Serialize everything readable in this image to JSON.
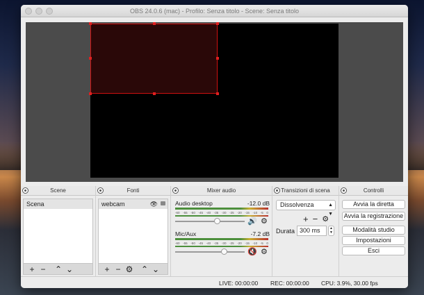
{
  "window": {
    "title": "OBS 24.0.6 (mac) - Profilo: Senza titolo - Scene: Senza titolo"
  },
  "docks": {
    "scenes": {
      "title": "Scene",
      "items": [
        "Scena"
      ]
    },
    "sources": {
      "title": "Fonti",
      "items": [
        "webcam"
      ]
    },
    "mixer": {
      "title": "Mixer audio",
      "ticks": [
        "-60",
        "-55",
        "-50",
        "-45",
        "-40",
        "-35",
        "-30",
        "-25",
        "-20",
        "-15",
        "-10",
        "-5",
        "0"
      ],
      "tracks": [
        {
          "name": "Audio desktop",
          "db": "-12.0 dB",
          "volume_fraction": 0.6,
          "muted": false
        },
        {
          "name": "Mic/Aux",
          "db": "-7.2 dB",
          "volume_fraction": 0.7,
          "muted": true
        }
      ]
    },
    "transitions": {
      "title": "Transizioni di scena",
      "selected": "Dissolvenza",
      "duration_label": "Durata",
      "duration_value": "300 ms"
    },
    "controls": {
      "title": "Controlli",
      "buttons": [
        "Avvia la diretta",
        "Avvia la registrazione",
        "Modalità studio",
        "Impostazioni",
        "Esci"
      ]
    }
  },
  "status": {
    "live": "LIVE: 00:00:00",
    "rec": "REC: 00:00:00",
    "cpu": "CPU: 3.9%, 30.00 fps"
  },
  "colors": {
    "selection": "#d01010",
    "canvas": "#000000",
    "preview_bg": "#4b4b4b"
  }
}
